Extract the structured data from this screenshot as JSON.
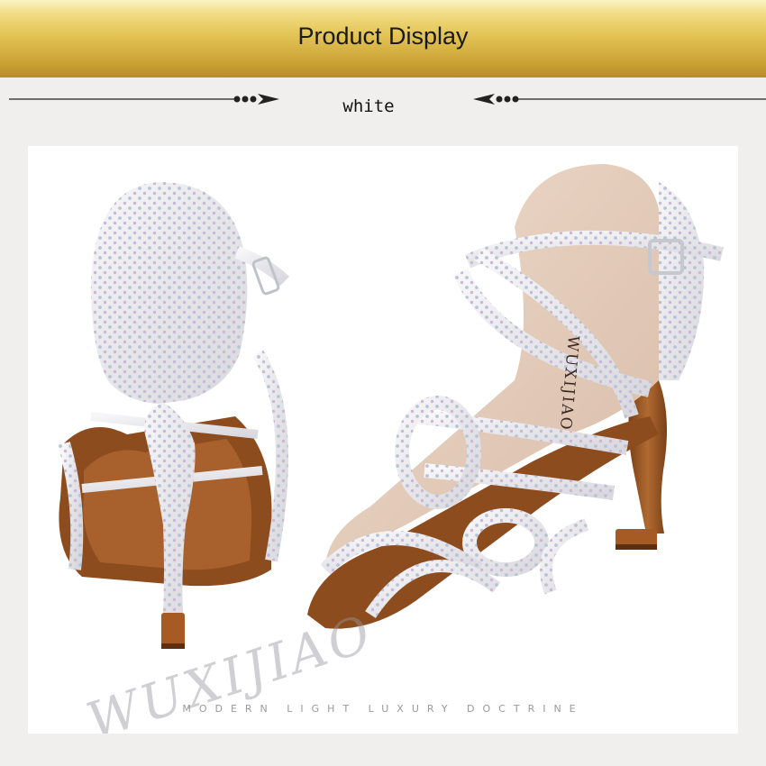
{
  "banner": {
    "title": "Product Display"
  },
  "variant": {
    "color_label": "white"
  },
  "product": {
    "brand_mark": "WUXIJIAO",
    "insole_text": "WUXIJIAO",
    "tagline": "MODERN LIGHT LUXURY DOCTRINE"
  },
  "colors": {
    "banner_gold": "#d9b64a",
    "satin_white": "#eeeef0",
    "heel_brown": "#9a5a2a",
    "lining_beige": "#e6cfbf"
  }
}
